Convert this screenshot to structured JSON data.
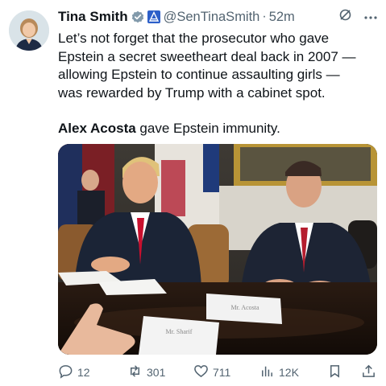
{
  "tweet": {
    "author_name": "Tina Smith",
    "handle": "@SenTinaSmith",
    "separator": "·",
    "time": "52m",
    "text_line1": "Let’s not forget that the prosecutor who gave",
    "text_line2": "Epstein a secret sweetheart deal back in 2007 —",
    "text_line3": "allowing Epstein to continue assaulting girls —",
    "text_line4": "was rewarded by Trump with a cabinet spot.",
    "text_bold": "Alex Acosta",
    "text_tail": " gave Epstein immunity."
  },
  "media": {
    "placard_1": "Mr. Acosta",
    "placard_2": "Mr. Sharif"
  },
  "actions": {
    "replies": "12",
    "reposts": "301",
    "likes": "711",
    "views": "12K"
  },
  "icons": [
    "verified-badge-icon",
    "government-badge-icon",
    "grok-icon",
    "more-icon",
    "reply-icon",
    "repost-icon",
    "like-icon",
    "views-icon",
    "bookmark-icon",
    "share-icon"
  ],
  "colors": {
    "verified": "#829aab",
    "accent": "#1d9bf0",
    "muted": "#536471"
  }
}
